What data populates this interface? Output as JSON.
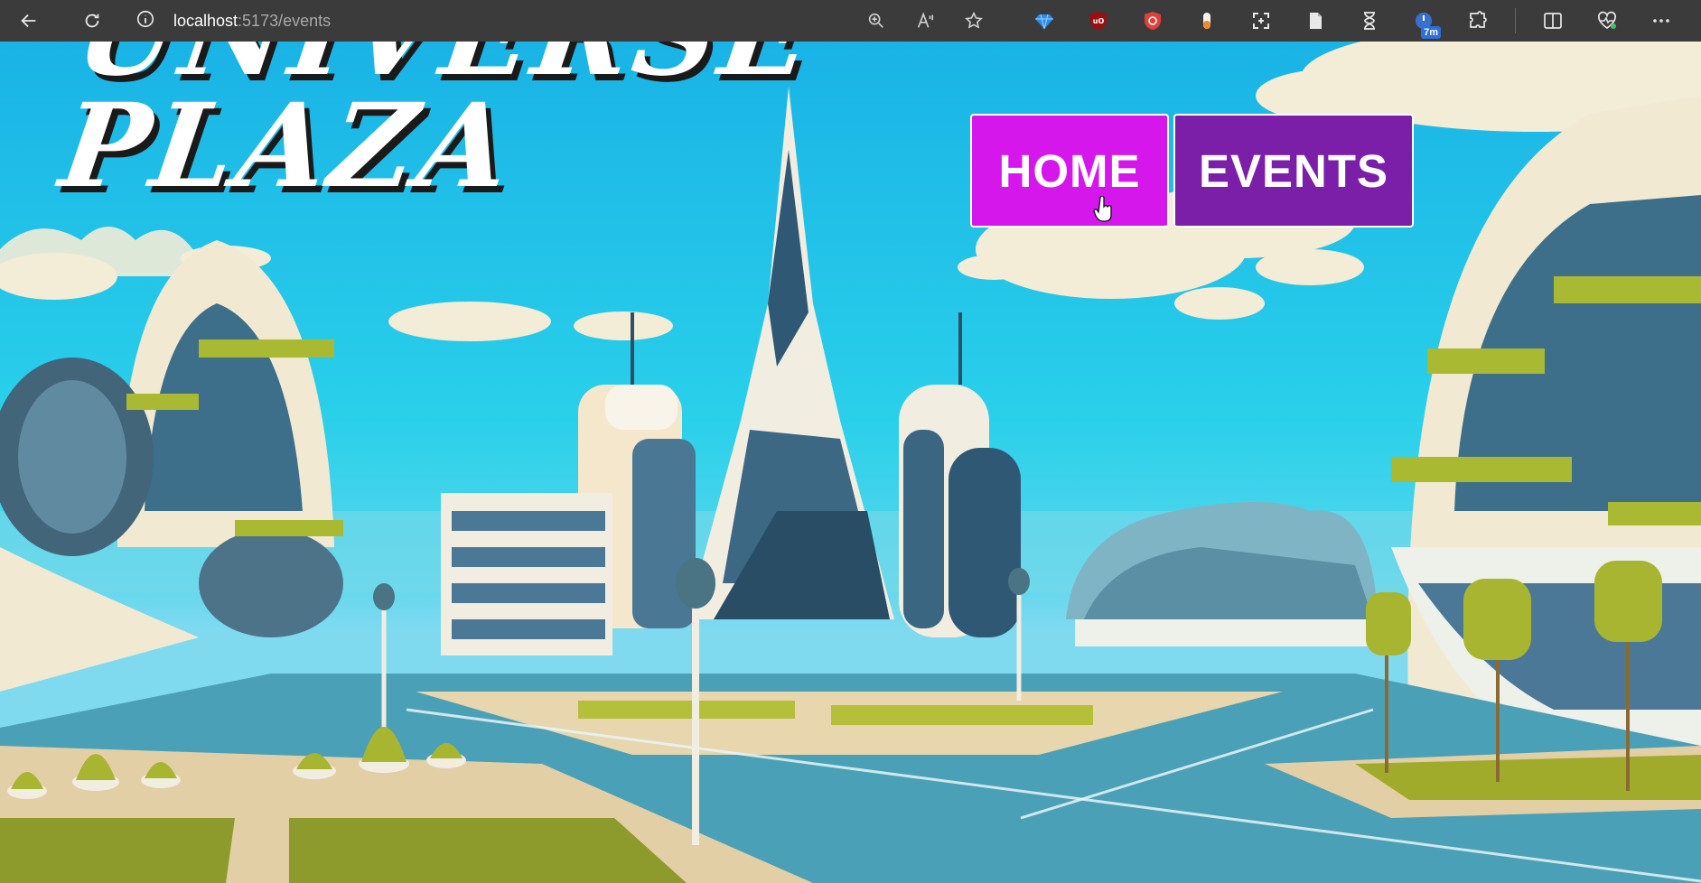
{
  "browser": {
    "url_host": "localhost",
    "url_path": ":5173/events",
    "tab_timer_badge": "7m"
  },
  "site": {
    "title": "UNIVERSE\nPLAZA"
  },
  "nav": {
    "home_label": "HOME",
    "events_label": "EVENTS"
  },
  "colors": {
    "home_button": "#d517ec",
    "events_button": "#7b1fa8",
    "sky": "#19b3e6"
  },
  "icons": [
    "back-icon",
    "refresh-icon",
    "info-icon",
    "zoom-icon",
    "read-aloud-icon",
    "favorite-star-icon",
    "gem-extension-icon",
    "ublock-icon",
    "shield-extension-icon",
    "capsule-extension-icon",
    "screenshot-icon",
    "document-icon",
    "hourglass-icon",
    "timer-extension-icon",
    "puzzle-extensions-icon",
    "split-screen-icon",
    "health-icon",
    "more-menu-icon"
  ]
}
